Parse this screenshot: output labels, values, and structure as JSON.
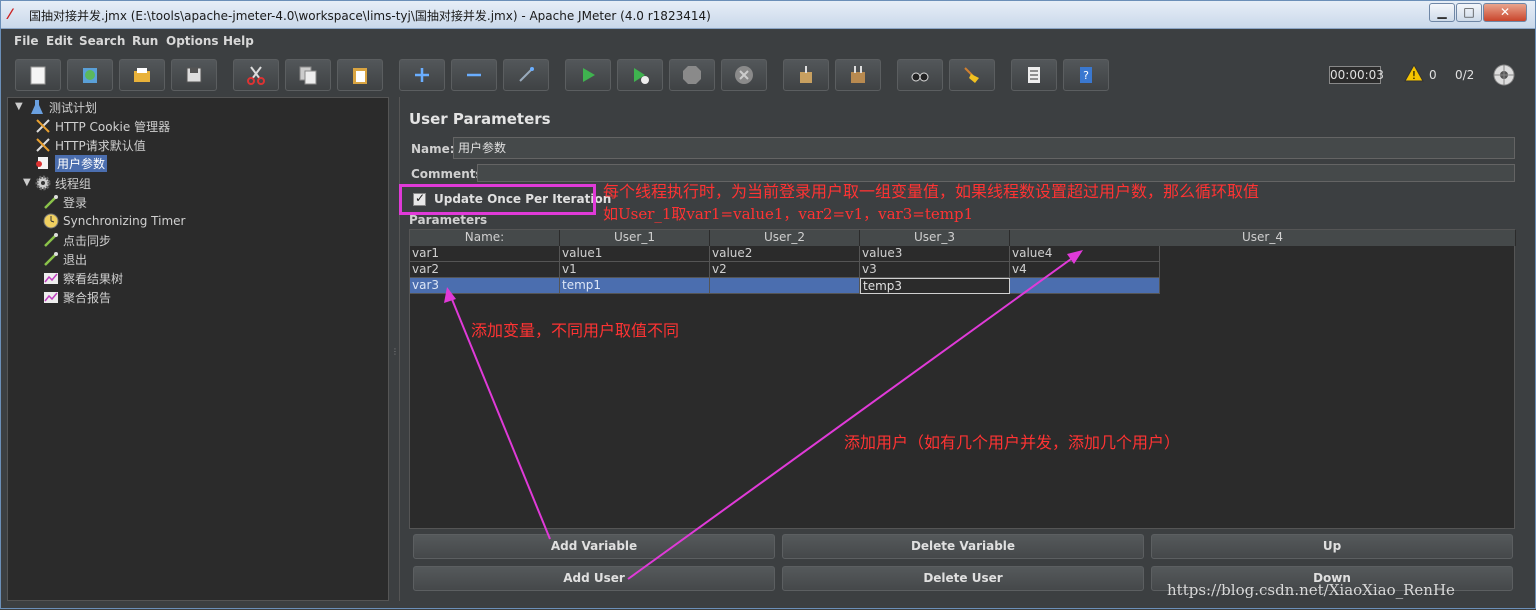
{
  "window": {
    "title": "国抽对接并发.jmx (E:\\tools\\apache-jmeter-4.0\\workspace\\lims-tyj\\国抽对接并发.jmx) - Apache JMeter (4.0 r1823414)",
    "min_label": "▁",
    "max_label": "□",
    "close_label": "✕"
  },
  "menu": {
    "file": "File",
    "edit": "Edit",
    "search": "Search",
    "run": "Run",
    "options": "Options",
    "help": "Help"
  },
  "toolbar": {
    "timer": "00:00:03",
    "warnings": "0",
    "threads": "0/2"
  },
  "tree": {
    "items": [
      {
        "label": "测试计划",
        "icon": "flask-icon"
      },
      {
        "label": "HTTP Cookie 管理器",
        "icon": "wrench-icon"
      },
      {
        "label": "HTTP请求默认值",
        "icon": "wrench-icon"
      },
      {
        "label": "用户参数",
        "icon": "pre-processor-icon"
      },
      {
        "label": "线程组",
        "icon": "gear-icon"
      },
      {
        "label": "登录",
        "icon": "pipette-icon"
      },
      {
        "label": "Synchronizing Timer",
        "icon": "timer-icon"
      },
      {
        "label": "点击同步",
        "icon": "pipette-icon"
      },
      {
        "label": "退出",
        "icon": "pipette-icon"
      },
      {
        "label": "察看结果树",
        "icon": "listener-icon"
      },
      {
        "label": "聚合报告",
        "icon": "listener-icon"
      }
    ]
  },
  "panel": {
    "title": "User Parameters",
    "name_label": "Name:",
    "name_value": "用户参数",
    "comments_label": "Comments:",
    "comments_value": "",
    "checkbox_label": "Update Once Per Iteration",
    "checkbox_checked": true,
    "params_label": "Parameters"
  },
  "table": {
    "headers": [
      "Name:",
      "User_1",
      "User_2",
      "User_3",
      "User_4"
    ],
    "rows": [
      [
        "var1",
        "value1",
        "value2",
        "value3",
        "value4"
      ],
      [
        "var2",
        "v1",
        "v2",
        "v3",
        "v4"
      ],
      [
        "var3",
        "temp1",
        "",
        "temp3",
        ""
      ]
    ]
  },
  "buttons": {
    "add_variable": "Add Variable",
    "delete_variable": "Delete Variable",
    "up": "Up",
    "add_user": "Add User",
    "delete_user": "Delete User",
    "down": "Down"
  },
  "annotations": {
    "line1": "每个线程执行时，为当前登录用户取一组变量值，如果线程数设置超过用户数，那么循环取值",
    "line2": "如User_1取var1=value1，var2=v1，var3=temp1",
    "add_var_note": "添加变量，不同用户取值不同",
    "add_user_note": "添加用户（如有几个用户并发，添加几个用户）",
    "arrow_color": "#e03ad8",
    "text_color": "#ff3333"
  },
  "watermark": "https://blog.csdn.net/XiaoXiao_RenHe"
}
